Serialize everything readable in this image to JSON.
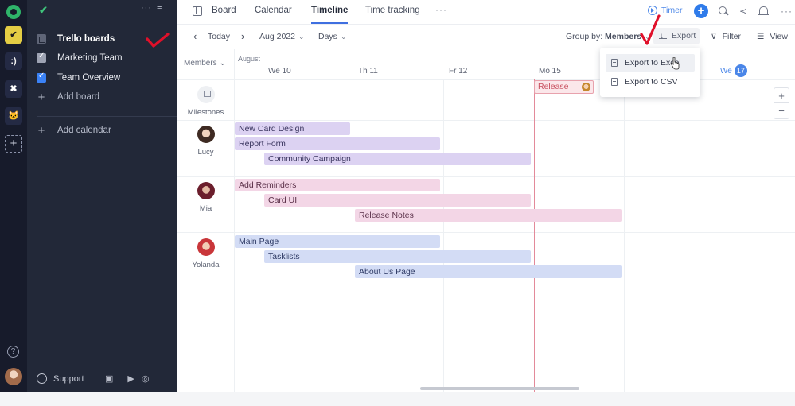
{
  "rail": {
    "workspaces": [
      {
        "name": "ws-check",
        "glyph": "✔"
      },
      {
        "name": "ws-2",
        "glyph": ":)"
      },
      {
        "name": "ws-3",
        "glyph": "✖"
      },
      {
        "name": "ws-4",
        "glyph": "🐱"
      }
    ],
    "add_glyph": "+",
    "help_glyph": "?"
  },
  "sidebar": {
    "top_check": "✔",
    "dots": "···",
    "collapse": "≡",
    "items": [
      {
        "label": "Trello boards"
      },
      {
        "label": "Marketing Team"
      },
      {
        "label": "Team Overview"
      },
      {
        "label": "Add board"
      },
      {
        "label": "Add calendar"
      }
    ],
    "support_label": "Support",
    "apps": [
      "▣",
      "",
      "▶",
      "◎"
    ]
  },
  "topbar": {
    "tabs": [
      {
        "label": "Board"
      },
      {
        "label": "Calendar"
      },
      {
        "label": "Timeline"
      },
      {
        "label": "Time tracking"
      }
    ],
    "more": "···",
    "timer_label": "Timer",
    "plus": "+",
    "share_glyph": "≺",
    "more_right": "···"
  },
  "toolbar": {
    "prev": "‹",
    "today": "Today",
    "next": "›",
    "month": "Aug 2022",
    "view": "Days",
    "chev": "⌄",
    "group_by_label": "Group by:",
    "group_by_value": "Members",
    "export_label": "Export",
    "filter_label": "Filter",
    "view_label": "View"
  },
  "timeline": {
    "members_header": "Members",
    "month_label": "August",
    "days": [
      {
        "label": "We 10"
      },
      {
        "label": "Th 11"
      },
      {
        "label": "Fr 12"
      },
      {
        "label": "Mo 15"
      },
      {
        "label": "We",
        "badge": "17"
      }
    ],
    "milestones_label": "Milestones",
    "milestone": "Release",
    "members": [
      {
        "name": "Lucy",
        "tasks": [
          "New Card Design",
          "Report Form",
          "Community Campaign"
        ]
      },
      {
        "name": "Mia",
        "tasks": [
          "Add Reminders",
          "Card UI",
          "Release Notes"
        ]
      },
      {
        "name": "Yolanda",
        "tasks": [
          "Main Page",
          "Tasklists",
          "About Us Page"
        ]
      }
    ],
    "zoom_in": "+",
    "zoom_out": "−"
  },
  "export_menu": {
    "items": [
      {
        "label": "Export to Excel"
      },
      {
        "label": "Export to CSV"
      }
    ]
  },
  "colors": {
    "accent": "#4a86e8",
    "annotation": "#e0102a",
    "lucy": "#dcd2f2",
    "mia": "#f3d6e6",
    "yolanda": "#d3dcf5",
    "today_line": "#e38a9a"
  }
}
